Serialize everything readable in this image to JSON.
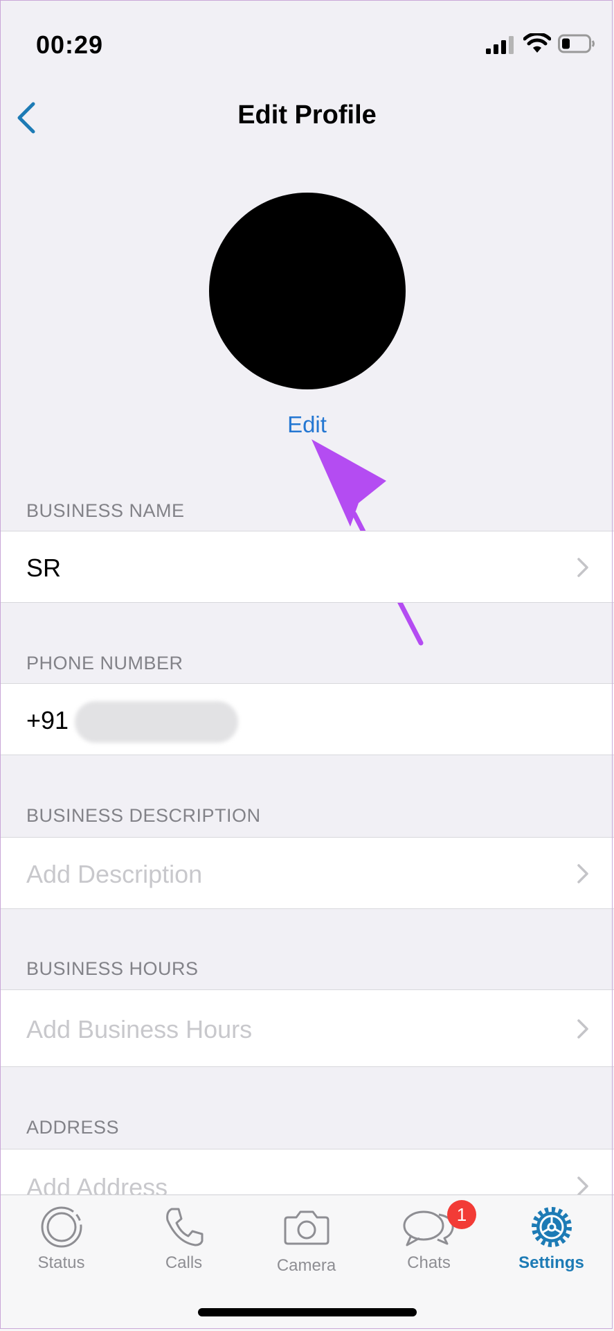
{
  "status_bar": {
    "time": "00:29"
  },
  "nav": {
    "title": "Edit Profile"
  },
  "profile": {
    "edit_label": "Edit"
  },
  "sections": {
    "business_name": {
      "label": "BUSINESS NAME",
      "value": "SR"
    },
    "phone": {
      "label": "PHONE NUMBER",
      "value": "+91"
    },
    "description": {
      "label": "BUSINESS DESCRIPTION",
      "placeholder": "Add Description"
    },
    "hours": {
      "label": "BUSINESS HOURS",
      "placeholder": "Add Business Hours"
    },
    "address": {
      "label": "ADDRESS",
      "placeholder": "Add Address"
    }
  },
  "tabs": [
    {
      "label": "Status",
      "icon": "status-icon"
    },
    {
      "label": "Calls",
      "icon": "phone-icon"
    },
    {
      "label": "Camera",
      "icon": "camera-icon"
    },
    {
      "label": "Chats",
      "icon": "chat-bubbles-icon",
      "badge": "1"
    },
    {
      "label": "Settings",
      "icon": "gear-icon",
      "active": true
    }
  ],
  "colors": {
    "accent": "#2477d2",
    "settings_active": "#1d7bb5",
    "badge": "#f23b36",
    "annotation_arrow": "#b44cf2"
  }
}
